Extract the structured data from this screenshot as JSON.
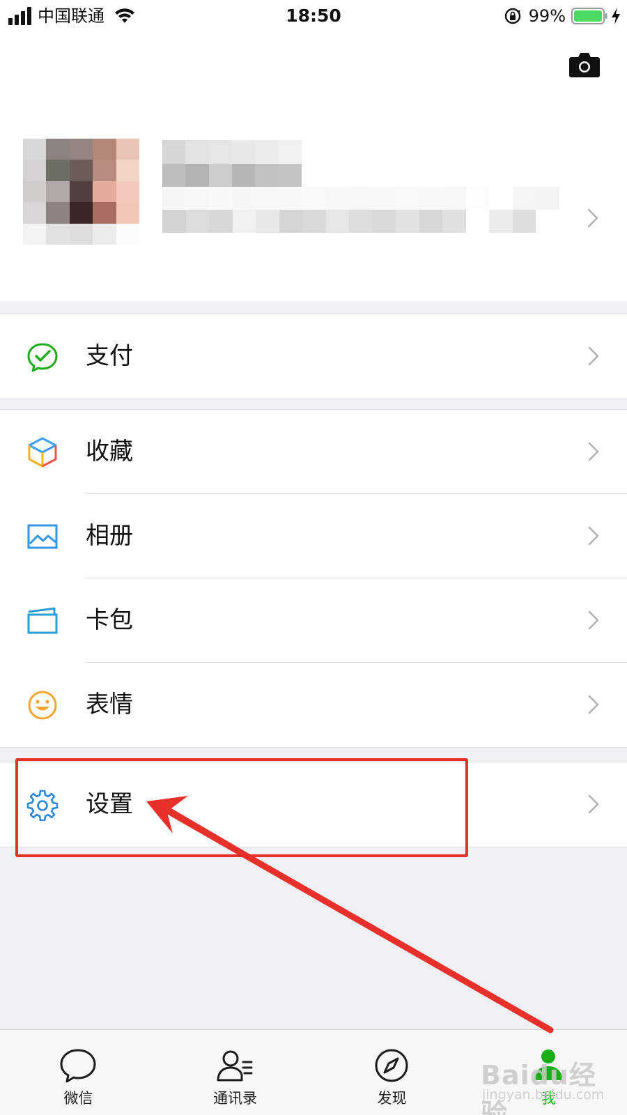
{
  "status_bar": {
    "carrier": "中国联通",
    "time": "18:50",
    "battery_percent": "99%"
  },
  "profile": {
    "name_blurred": true,
    "avatar_blurred": true
  },
  "menu": {
    "group_pay": [
      {
        "label": "支付",
        "icon": "wechat-pay-icon"
      }
    ],
    "group_main": [
      {
        "label": "收藏",
        "icon": "favorites-cube-icon"
      },
      {
        "label": "相册",
        "icon": "album-picture-icon"
      },
      {
        "label": "卡包",
        "icon": "card-wallet-icon"
      },
      {
        "label": "表情",
        "icon": "sticker-smiley-icon"
      }
    ],
    "group_settings": [
      {
        "label": "设置",
        "icon": "settings-gear-icon"
      }
    ]
  },
  "tabbar": {
    "tabs": [
      {
        "label": "微信",
        "icon": "chat-bubble-icon",
        "active": false
      },
      {
        "label": "通讯录",
        "icon": "contacts-icon",
        "active": false
      },
      {
        "label": "发现",
        "icon": "compass-icon",
        "active": false
      },
      {
        "label": "我",
        "icon": "me-person-icon",
        "active": true
      }
    ]
  },
  "watermark": {
    "main": "Baidu经验",
    "sub": "jingyan.baidu.com"
  },
  "colors": {
    "accent_green": "#1aad19",
    "annotation_red": "#e8302a",
    "background": "#efeff4"
  }
}
